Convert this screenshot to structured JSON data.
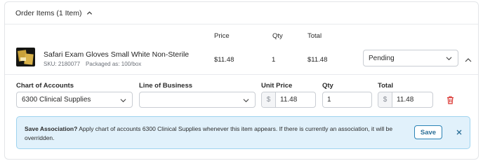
{
  "header": {
    "title": "Order Items (1 Item)",
    "toggle_icon": "chevron-up-icon"
  },
  "columns": {
    "price": "Price",
    "qty": "Qty",
    "total": "Total"
  },
  "item": {
    "name": "Safari Exam Gloves Small White Non-Sterile",
    "sku": "SKU: 2180077",
    "packaged": "Packaged as: 100/box",
    "price": "$11.48",
    "qty": "1",
    "total": "$11.48",
    "status": "Pending"
  },
  "fields": {
    "chart_of_accounts": {
      "label": "Chart of Accounts",
      "value": "6300 Clinical Supplies"
    },
    "line_of_business": {
      "label": "Line of Business",
      "value": ""
    },
    "unit_price": {
      "label": "Unit Price",
      "prefix": "$",
      "value": "11.48"
    },
    "qty": {
      "label": "Qty",
      "value": "1"
    },
    "total": {
      "label": "Total",
      "prefix": "$",
      "value": "11.48"
    }
  },
  "banner": {
    "title": "Save Association?",
    "message": "Apply chart of accounts 6300 Clinical Supplies whenever this item appears. If there is currently an association, it will be overridden.",
    "save_label": "Save"
  },
  "colors": {
    "accent": "#2b83b6",
    "banner_bg": "#e1f1fb",
    "banner_border": "#9fd3ef",
    "delete": "#d9302c"
  }
}
